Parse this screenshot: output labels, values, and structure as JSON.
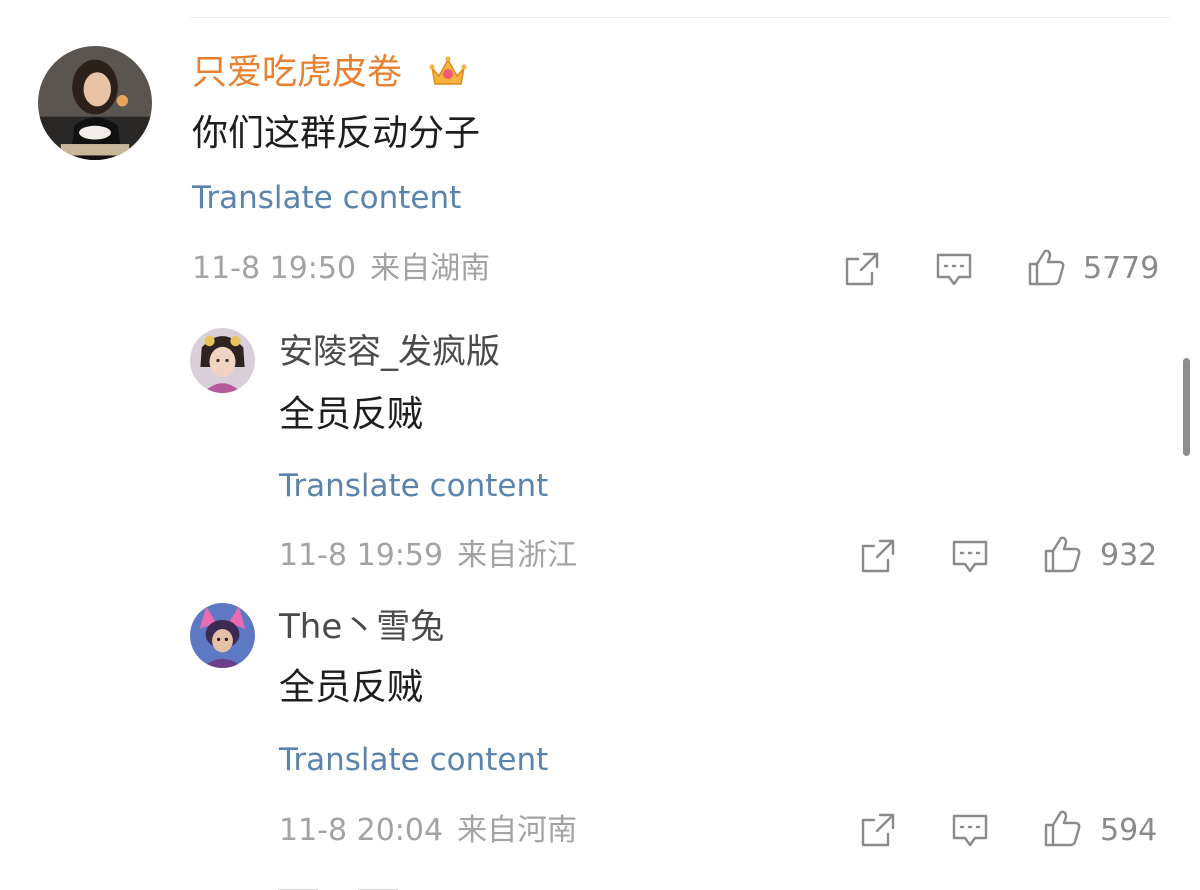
{
  "comments": [
    {
      "username": "只爱吃虎皮卷",
      "badge_icon": "crown-icon",
      "content": "你们这群反动分子",
      "translate_label": "Translate content",
      "date": "11-8 19:50",
      "location": "来自湖南",
      "likes": "5779",
      "replies": [
        {
          "username": "安陵容_发疯版",
          "content": "全员反贼",
          "translate_label": "Translate content",
          "date": "11-8 19:59",
          "location": "来自浙江",
          "likes": "932"
        },
        {
          "username": "The丶雪兔",
          "content": "全员反贼",
          "translate_label": "Translate content",
          "date": "11-8 20:04",
          "location": "来自河南",
          "likes": "594"
        }
      ]
    }
  ],
  "colors": {
    "username_vip": "#e8802f",
    "link": "#5b84ad",
    "meta": "#a3a3a3",
    "text": "#1e1e1e"
  },
  "icons": [
    "share-icon",
    "comment-icon",
    "like-icon"
  ]
}
